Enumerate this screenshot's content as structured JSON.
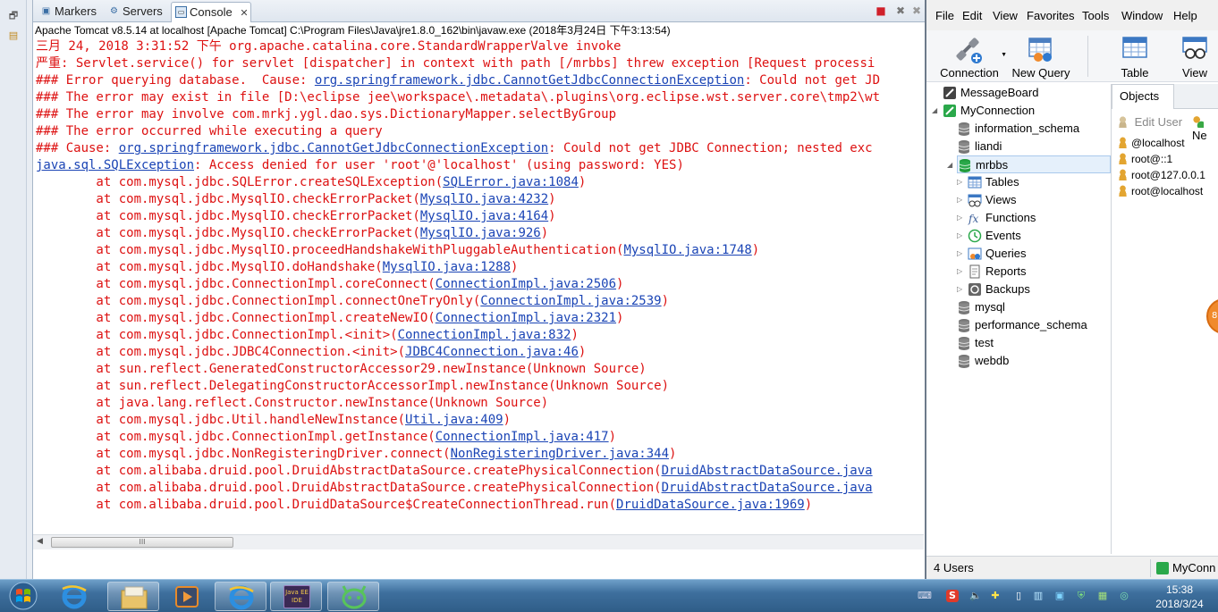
{
  "eclipse": {
    "tabs": [
      {
        "label": "Markers",
        "icon": "markers-icon"
      },
      {
        "label": "Servers",
        "icon": "servers-icon"
      },
      {
        "label": "Console",
        "icon": "console-icon",
        "close": "✕"
      }
    ],
    "process_line": "Apache Tomcat v8.5.14 at localhost [Apache Tomcat] C:\\Program Files\\Java\\jre1.8.0_162\\bin\\javaw.exe (2018年3月24日 下午3:13:54)",
    "console": [
      [
        "三月 24, 2018 3:31:52 下午 org.apache.catalina.core.StandardWrapperValve invoke"
      ],
      [
        "严重: Servlet.service() for servlet [dispatcher] in context with path [/mrbbs] threw exception [Request processi"
      ],
      [
        "### Error querying database.  Cause: ",
        {
          "link": "org.springframework.jdbc.CannotGetJdbcConnectionException"
        },
        ": Could not get JD"
      ],
      [
        "### The error may exist in file [D:\\eclipse jee\\workspace\\.metadata\\.plugins\\org.eclipse.wst.server.core\\tmp2\\wt"
      ],
      [
        "### The error may involve com.mrkj.ygl.dao.sys.DictionaryMapper.selectByGroup"
      ],
      [
        "### The error occurred while executing a query"
      ],
      [
        "### Cause: ",
        {
          "link": "org.springframework.jdbc.CannotGetJdbcConnectionException"
        },
        ": Could not get JDBC Connection; nested exc"
      ],
      [
        {
          "link": "java.sql.SQLException"
        },
        ": Access denied for user 'root'@'localhost' (using password: YES)"
      ],
      [
        "        at com.mysql.jdbc.SQLError.createSQLException(",
        {
          "link": "SQLError.java:1084"
        },
        ")"
      ],
      [
        "        at com.mysql.jdbc.MysqlIO.checkErrorPacket(",
        {
          "link": "MysqlIO.java:4232"
        },
        ")"
      ],
      [
        "        at com.mysql.jdbc.MysqlIO.checkErrorPacket(",
        {
          "link": "MysqlIO.java:4164"
        },
        ")"
      ],
      [
        "        at com.mysql.jdbc.MysqlIO.checkErrorPacket(",
        {
          "link": "MysqlIO.java:926"
        },
        ")"
      ],
      [
        "        at com.mysql.jdbc.MysqlIO.proceedHandshakeWithPluggableAuthentication(",
        {
          "link": "MysqlIO.java:1748"
        },
        ")"
      ],
      [
        "        at com.mysql.jdbc.MysqlIO.doHandshake(",
        {
          "link": "MysqlIO.java:1288"
        },
        ")"
      ],
      [
        "        at com.mysql.jdbc.ConnectionImpl.coreConnect(",
        {
          "link": "ConnectionImpl.java:2506"
        },
        ")"
      ],
      [
        "        at com.mysql.jdbc.ConnectionImpl.connectOneTryOnly(",
        {
          "link": "ConnectionImpl.java:2539"
        },
        ")"
      ],
      [
        "        at com.mysql.jdbc.ConnectionImpl.createNewIO(",
        {
          "link": "ConnectionImpl.java:2321"
        },
        ")"
      ],
      [
        "        at com.mysql.jdbc.ConnectionImpl.<init>(",
        {
          "link": "ConnectionImpl.java:832"
        },
        ")"
      ],
      [
        "        at com.mysql.jdbc.JDBC4Connection.<init>(",
        {
          "link": "JDBC4Connection.java:46"
        },
        ")"
      ],
      [
        "        at sun.reflect.GeneratedConstructorAccessor29.newInstance(Unknown Source)"
      ],
      [
        "        at sun.reflect.DelegatingConstructorAccessorImpl.newInstance(Unknown Source)"
      ],
      [
        "        at java.lang.reflect.Constructor.newInstance(Unknown Source)"
      ],
      [
        "        at com.mysql.jdbc.Util.handleNewInstance(",
        {
          "link": "Util.java:409"
        },
        ")"
      ],
      [
        "        at com.mysql.jdbc.ConnectionImpl.getInstance(",
        {
          "link": "ConnectionImpl.java:417"
        },
        ")"
      ],
      [
        "        at com.mysql.jdbc.NonRegisteringDriver.connect(",
        {
          "link": "NonRegisteringDriver.java:344"
        },
        ")"
      ],
      [
        "        at com.alibaba.druid.pool.DruidAbstractDataSource.createPhysicalConnection(",
        {
          "link": "DruidAbstractDataSource.java"
        }
      ],
      [
        "        at com.alibaba.druid.pool.DruidAbstractDataSource.createPhysicalConnection(",
        {
          "link": "DruidAbstractDataSource.java"
        }
      ],
      [
        "        at com.alibaba.druid.pool.DruidDataSource$CreateConnectionThread.run(",
        {
          "link": "DruidDataSource.java:1969"
        },
        ")"
      ]
    ],
    "scroll_thumb_glyph": "III"
  },
  "navicat": {
    "menu": [
      "File",
      "Edit",
      "View",
      "Favorites",
      "Tools",
      "Window",
      "Help"
    ],
    "toolbar": {
      "connection": "Connection",
      "new_query": "New Query",
      "table": "Table",
      "view": "View"
    },
    "tree": {
      "top": "MessageBoard",
      "connection": "MyConnection",
      "databases": [
        "information_schema",
        "liandi",
        "mrbbs",
        "mysql",
        "performance_schema",
        "test",
        "webdb"
      ],
      "mrbbs_children": [
        "Tables",
        "Views",
        "Functions",
        "Events",
        "Queries",
        "Reports",
        "Backups"
      ]
    },
    "objects_tab": "Objects",
    "edit_user": "Edit User",
    "new_user_partial": "Ne",
    "users": [
      "@localhost",
      "root@::1",
      "root@127.0.0.1",
      "root@localhost"
    ],
    "badge": "88",
    "status_users": "4 Users",
    "status_connection": "MyConn"
  },
  "taskbar": {
    "time": "15:38",
    "date": "2018/3/24",
    "eclipse_label": "Java EE IDE"
  },
  "colors": {
    "console_error": "#d11111",
    "console_link": "#1a44b5",
    "taskbar": "#3e6f9d"
  }
}
